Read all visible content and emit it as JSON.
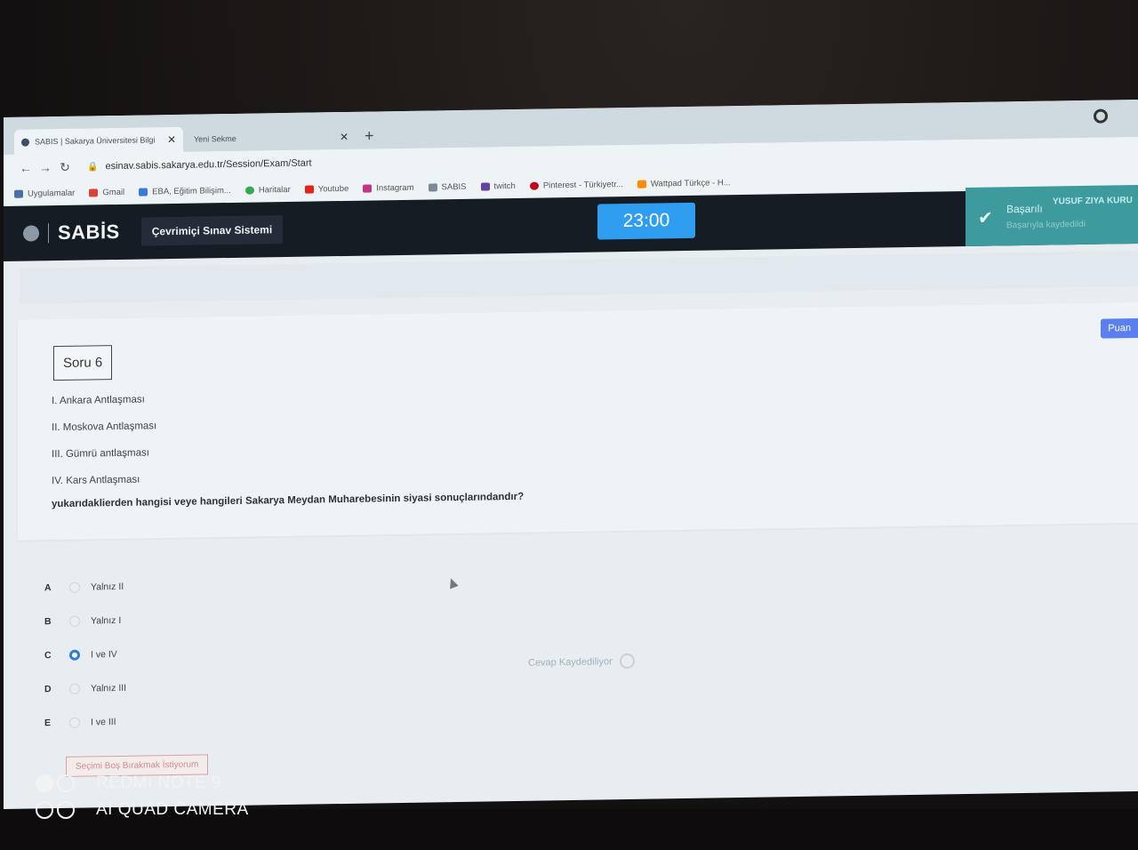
{
  "browser": {
    "tabs": [
      {
        "title": "SABIS | Sakarya Üniversitesi Bilgi",
        "active": true
      },
      {
        "title": "Yeni Sekme",
        "active": false
      }
    ],
    "new_tab": "+",
    "url": "esinav.sabis.sakarya.edu.tr/Session/Exam/Start",
    "bookmarks": [
      {
        "label": "Uygulamalar",
        "icon": "apps-grid-icon",
        "color": "#4a6fa5"
      },
      {
        "label": "Gmail",
        "icon": "gmail-icon",
        "color": "#d44638"
      },
      {
        "label": "EBA, Eğitim Bilişim...",
        "icon": "eba-icon",
        "color": "#3a7bd5"
      },
      {
        "label": "Haritalar",
        "icon": "maps-pin-icon",
        "color": "#34a853"
      },
      {
        "label": "Youtube",
        "icon": "youtube-icon",
        "color": "#e62117"
      },
      {
        "label": "Instagram",
        "icon": "instagram-icon",
        "color": "#c13584"
      },
      {
        "label": "SABIS",
        "icon": "sabis-doc-icon",
        "color": "#7a8a99"
      },
      {
        "label": "twitch",
        "icon": "twitch-icon",
        "color": "#6441a5"
      },
      {
        "label": "Pinterest - Türkiyetr...",
        "icon": "pinterest-icon",
        "color": "#bd081c"
      },
      {
        "label": "Wattpad Türkçe - H...",
        "icon": "wattpad-icon",
        "color": "#ff8c00"
      }
    ]
  },
  "header": {
    "logo": "SABİS",
    "subsystem": "Çevrimiçi Sınav Sistemi",
    "timer": "23:00",
    "toast_title": "Başarılı",
    "toast_message": "Başarıyla kaydedildi",
    "user_name": "YUSUF ZIYA KURU"
  },
  "question": {
    "number_label": "Soru 6",
    "points_label": "Puan",
    "items": [
      "I. Ankara Antlaşması",
      "II. Moskova Antlaşması",
      "III. Gümrü antlaşması",
      "IV. Kars Antlaşması"
    ],
    "prompt": "yukarıdaklierden hangisi veye hangileri Sakarya Meydan Muharebesinin siyasi sonuçlarındandır?"
  },
  "options": [
    {
      "letter": "A",
      "text": "Yalnız II",
      "selected": false
    },
    {
      "letter": "B",
      "text": "Yalnız I",
      "selected": false
    },
    {
      "letter": "C",
      "text": "I ve IV",
      "selected": true
    },
    {
      "letter": "D",
      "text": "Yalnız III",
      "selected": false
    },
    {
      "letter": "E",
      "text": "I ve III",
      "selected": false
    }
  ],
  "saving_status": "Cevap Kaydediliyor",
  "leave_blank_button": "Seçimi Boş Bırakmak İstiyorum",
  "watermark": {
    "line1": "REDMI NOTE 9",
    "line2": "AI QUAD CAMERA"
  },
  "colors": {
    "header_bg": "#161c24",
    "timer_bg": "#2f9df0",
    "toast_bg": "#3d9a9d",
    "points_badge": "#5c7ff0",
    "selected_radio": "#2f7ed8"
  }
}
